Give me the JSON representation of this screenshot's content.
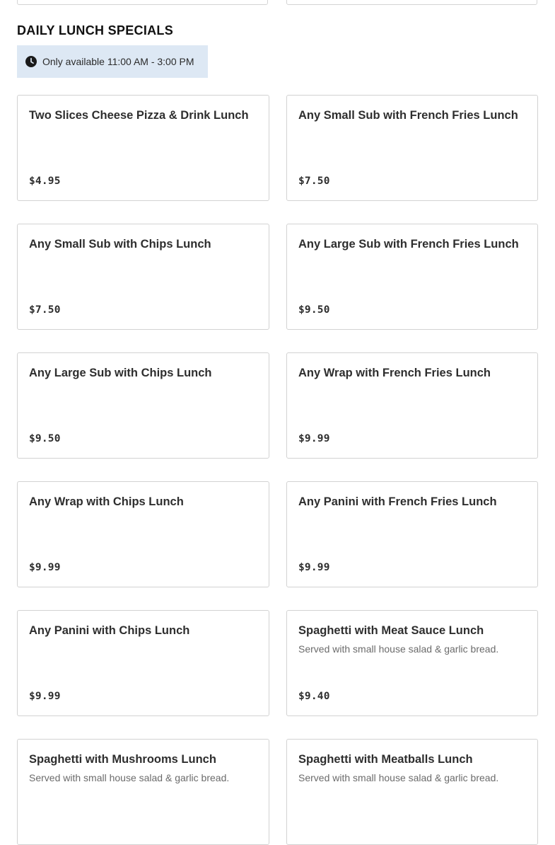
{
  "section": {
    "title": "DAILY LUNCH SPECIALS",
    "availability": "Only available 11:00 AM - 3:00 PM",
    "clock_icon": "clock-icon"
  },
  "items": [
    {
      "name": "Two Slices Cheese Pizza & Drink Lunch",
      "description": "",
      "price": "$4.95"
    },
    {
      "name": "Any Small Sub with French Fries Lunch",
      "description": "",
      "price": "$7.50"
    },
    {
      "name": "Any Small Sub with Chips Lunch",
      "description": "",
      "price": "$7.50"
    },
    {
      "name": "Any Large Sub with French Fries Lunch",
      "description": "",
      "price": "$9.50"
    },
    {
      "name": "Any Large Sub with Chips Lunch",
      "description": "",
      "price": "$9.50"
    },
    {
      "name": "Any Wrap with French Fries Lunch",
      "description": "",
      "price": "$9.99"
    },
    {
      "name": "Any Wrap with Chips Lunch",
      "description": "",
      "price": "$9.99"
    },
    {
      "name": "Any Panini with French Fries Lunch",
      "description": "",
      "price": "$9.99"
    },
    {
      "name": "Any Panini with Chips Lunch",
      "description": "",
      "price": "$9.99"
    },
    {
      "name": "Spaghetti with Meat Sauce Lunch",
      "description": "Served with small house salad & garlic bread.",
      "price": "$9.40"
    },
    {
      "name": "Spaghetti with Mushrooms Lunch",
      "description": "Served with small house salad & garlic bread.",
      "price": ""
    },
    {
      "name": "Spaghetti with Meatballs Lunch",
      "description": "Served with small house salad & garlic bread.",
      "price": ""
    }
  ],
  "colors": {
    "availability_bg": "#dde8f4",
    "card_border": "#d2d2d2",
    "text_primary": "#2e2e2e",
    "text_secondary": "#6b6b6b"
  }
}
